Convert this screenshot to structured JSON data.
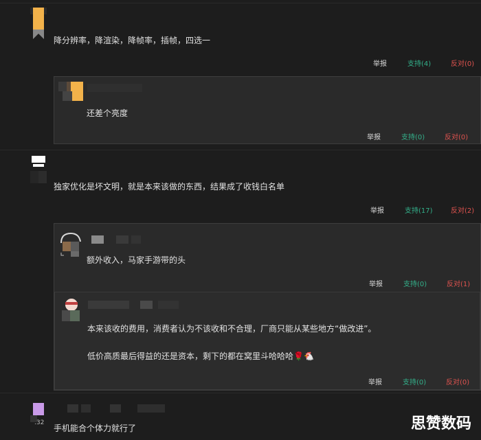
{
  "comments": [
    {
      "text": "降分辨率，降渲染，降帧率，插帧，四选一",
      "actions": {
        "report": "举报",
        "support": "支持(4)",
        "oppose": "反对(0)"
      },
      "replies": [
        {
          "text": "还差个亮度",
          "actions": {
            "report": "举报",
            "support": "支持(0)",
            "oppose": "反对(0)"
          }
        }
      ]
    },
    {
      "text": "独家优化是坏文明，就是本来该做的东西，结果成了收钱白名单",
      "actions": {
        "report": "举报",
        "support": "支持(17)",
        "oppose": "反对(2)"
      },
      "replies": [
        {
          "text": "额外收入，马家手游带的头",
          "actions": {
            "report": "举报",
            "support": "支持(0)",
            "oppose": "反对(1)"
          }
        },
        {
          "line1": "本来该收的费用，消费者认为不该收和不合理，厂商只能从某些地方“做改进”。",
          "line2": "低价高质最后得益的还是资本，剩下的都在窝里斗哈哈哈🌹🐔",
          "actions": {
            "report": "举报",
            "support": "支持(0)",
            "oppose": "反对(0)"
          }
        }
      ]
    },
    {
      "text": "手机能合个体力就行了",
      "badge": ".32"
    }
  ],
  "watermark": "思赞数码",
  "colors": {
    "background": "#1d1d1d",
    "support": "#33b08a",
    "oppose": "#e0534f",
    "reply_bg": "#2a2a2a"
  }
}
